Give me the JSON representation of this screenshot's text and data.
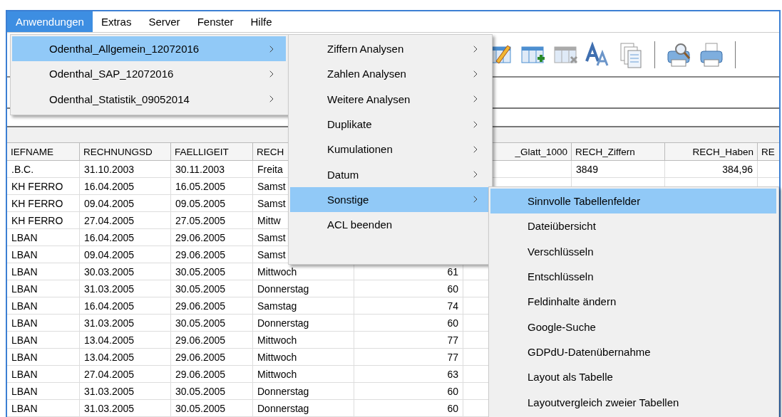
{
  "menubar": [
    {
      "label": "Anwendungen",
      "selected": true
    },
    {
      "label": "Extras",
      "selected": false
    },
    {
      "label": "Server",
      "selected": false
    },
    {
      "label": "Fenster",
      "selected": false
    },
    {
      "label": "Hilfe",
      "selected": false
    }
  ],
  "menus": [
    {
      "items": [
        {
          "label": "Odenthal_Allgemein_12072016",
          "selected": true,
          "submenu": true
        },
        {
          "label": "Odenthal_SAP_12072016",
          "selected": false,
          "submenu": true
        },
        {
          "label": "Odenthal_Statistik_09052014",
          "selected": false,
          "submenu": true
        }
      ]
    },
    {
      "items": [
        {
          "label": "Ziffern Analysen",
          "selected": false,
          "submenu": true
        },
        {
          "label": "Zahlen Analysen",
          "selected": false,
          "submenu": true
        },
        {
          "label": "Weitere Analysen",
          "selected": false,
          "submenu": true
        },
        {
          "label": "Duplikate",
          "selected": false,
          "submenu": true
        },
        {
          "label": "Kumulationen",
          "selected": false,
          "submenu": true
        },
        {
          "label": "Datum",
          "selected": false,
          "submenu": true
        },
        {
          "label": "Sonstige",
          "selected": true,
          "submenu": true
        },
        {
          "label": "ACL beenden",
          "selected": false,
          "submenu": false
        }
      ]
    },
    {
      "items": [
        {
          "label": "Sinnvolle Tabellenfelder",
          "selected": true,
          "submenu": false
        },
        {
          "label": "Dateiübersicht",
          "selected": false,
          "submenu": false
        },
        {
          "label": "Verschlüsseln",
          "selected": false,
          "submenu": false
        },
        {
          "label": "Entschlüsseln",
          "selected": false,
          "submenu": false
        },
        {
          "label": "Feldinhalte ändern",
          "selected": false,
          "submenu": false
        },
        {
          "label": "Google-Suche",
          "selected": false,
          "submenu": false
        },
        {
          "label": "GDPdU-Datenübernahme",
          "selected": false,
          "submenu": false
        },
        {
          "label": "Layout als Tabelle",
          "selected": false,
          "submenu": false
        },
        {
          "label": "Layoutvergleich zweier Tabellen",
          "selected": false,
          "submenu": false
        }
      ]
    }
  ],
  "table": {
    "columns": [
      {
        "label": "IEFNAME",
        "kind": "text"
      },
      {
        "label": "RECHNUNGSD",
        "kind": "text"
      },
      {
        "label": "FAELLIGEIT",
        "kind": "text"
      },
      {
        "label": "RECH",
        "kind": "text"
      },
      {
        "kind": "number"
      },
      {
        "label": "_Glatt_1000",
        "kind": "number"
      },
      {
        "label": "RECH_Ziffern",
        "kind": "text"
      },
      {
        "label": "RECH_Haben",
        "kind": "number"
      },
      {
        "label": "RE",
        "kind": "text"
      }
    ],
    "rows": [
      [
        ".B.C.",
        "31.10.2003",
        "30.11.2003",
        "Freita",
        null,
        null,
        "3849",
        "384,96",
        null
      ],
      [
        "KH FERRO",
        "16.04.2005",
        "16.05.2005",
        "Samst"
      ],
      [
        "KH FERRO",
        "09.04.2005",
        "09.05.2005",
        "Samst"
      ],
      [
        "KH FERRO",
        "27.04.2005",
        "27.05.2005",
        "Mittw"
      ],
      [
        "LBAN",
        "16.04.2005",
        "29.06.2005",
        "Samst"
      ],
      [
        "LBAN",
        "09.04.2005",
        "29.06.2005",
        "Samst"
      ],
      [
        "LBAN",
        "30.03.2005",
        "30.05.2005",
        "Mittwoch",
        "61"
      ],
      [
        "LBAN",
        "31.03.2005",
        "30.05.2005",
        "Donnerstag",
        "60"
      ],
      [
        "LBAN",
        "16.04.2005",
        "29.06.2005",
        "Samstag",
        "74"
      ],
      [
        "LBAN",
        "31.03.2005",
        "30.05.2005",
        "Donnerstag",
        "60"
      ],
      [
        "LBAN",
        "13.04.2005",
        "29.06.2005",
        "Mittwoch",
        "77"
      ],
      [
        "LBAN",
        "13.04.2005",
        "29.06.2005",
        "Mittwoch",
        "77"
      ],
      [
        "LBAN",
        "27.04.2005",
        "29.06.2005",
        "Mittwoch",
        "63"
      ],
      [
        "LBAN",
        "31.03.2005",
        "30.05.2005",
        "Donnerstag",
        "60"
      ],
      [
        "LBAN",
        "31.03.2005",
        "30.05.2005",
        "Donnerstag",
        "60"
      ]
    ]
  }
}
